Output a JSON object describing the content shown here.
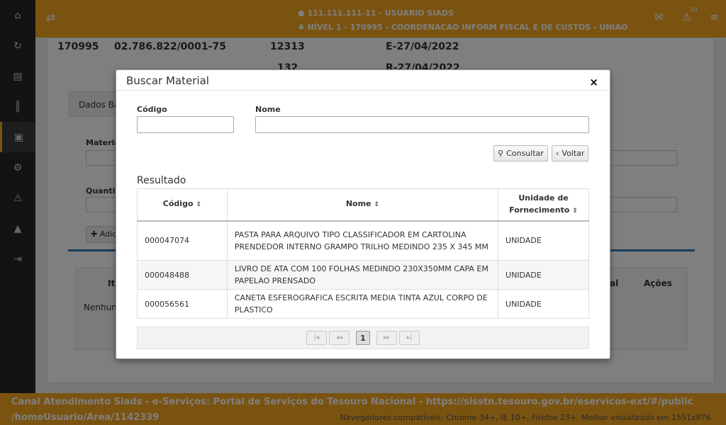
{
  "topbar": {
    "user": "111.111.111-11 - USUARIO SIADS",
    "level": "NÍVEL 1 - 170995 - COORDENACAO INFORM FISCAL E DE CUSTOS - UNIAO",
    "notification_count": "10"
  },
  "background": {
    "info_row1": [
      "170995",
      "02.786.822/0001-75",
      "12313",
      "E-27/04/2022"
    ],
    "info_row2": [
      "132",
      "R-27/04/2022"
    ],
    "tab_label": "Dados Básic",
    "material_label": "Materia",
    "quantity_label": "Quantic",
    "add_button": "Adic",
    "table_col_item": "Ite",
    "table_col_total": "al",
    "table_col_actions": "Ações",
    "table_empty": "Nenhum"
  },
  "modal": {
    "title": "Buscar Material",
    "close_label": "×",
    "codigo_label": "Código",
    "codigo_value": "",
    "nome_label": "Nome",
    "nome_value": "",
    "consultar_label": "Consultar",
    "voltar_label": "Voltar",
    "result_title": "Resultado",
    "columns": [
      "Código",
      "Nome",
      "Unidade de Fornecimento"
    ],
    "rows": [
      {
        "codigo": "000047074",
        "nome": "PASTA PARA ARQUIVO TIPO CLASSIFICADOR EM CARTOLINA PRENDEDOR INTERNO GRAMPO TRILHO MEDINDO 235 X 345 MM",
        "unidade": "UNIDADE"
      },
      {
        "codigo": "000048488",
        "nome": "LIVRO DE ATA COM 100 FOLHAS MEDINDO 230X350MM CAPA EM PAPELAO PRENSADO",
        "unidade": "UNIDADE"
      },
      {
        "codigo": "000056561",
        "nome": "CANETA ESFEROGRAFICA ESCRITA MEDIA TINTA AZUL CORPO DE PLASTICO",
        "unidade": "UNIDADE"
      }
    ],
    "pager": {
      "first": "|◂",
      "prev": "◂◂",
      "current": "1",
      "next": "▸▸",
      "last": "▸|"
    }
  },
  "footer": {
    "line1": "Canal Atendimento Siads - e-Serviços: Portal de Serviços do Tesouro Nacional - https://sisstn.tesouro.gov.br/eservicos-ext/#/public",
    "line2": "/homeUsuario/Area/1142339",
    "browsers": "Navegadores compatíveis: Chrome 34+, IE 10+, Firefox 23+. Melhor visualizado em 1551x876."
  },
  "colors": {
    "accent": "#f5a623",
    "sidebar": "#262626"
  }
}
